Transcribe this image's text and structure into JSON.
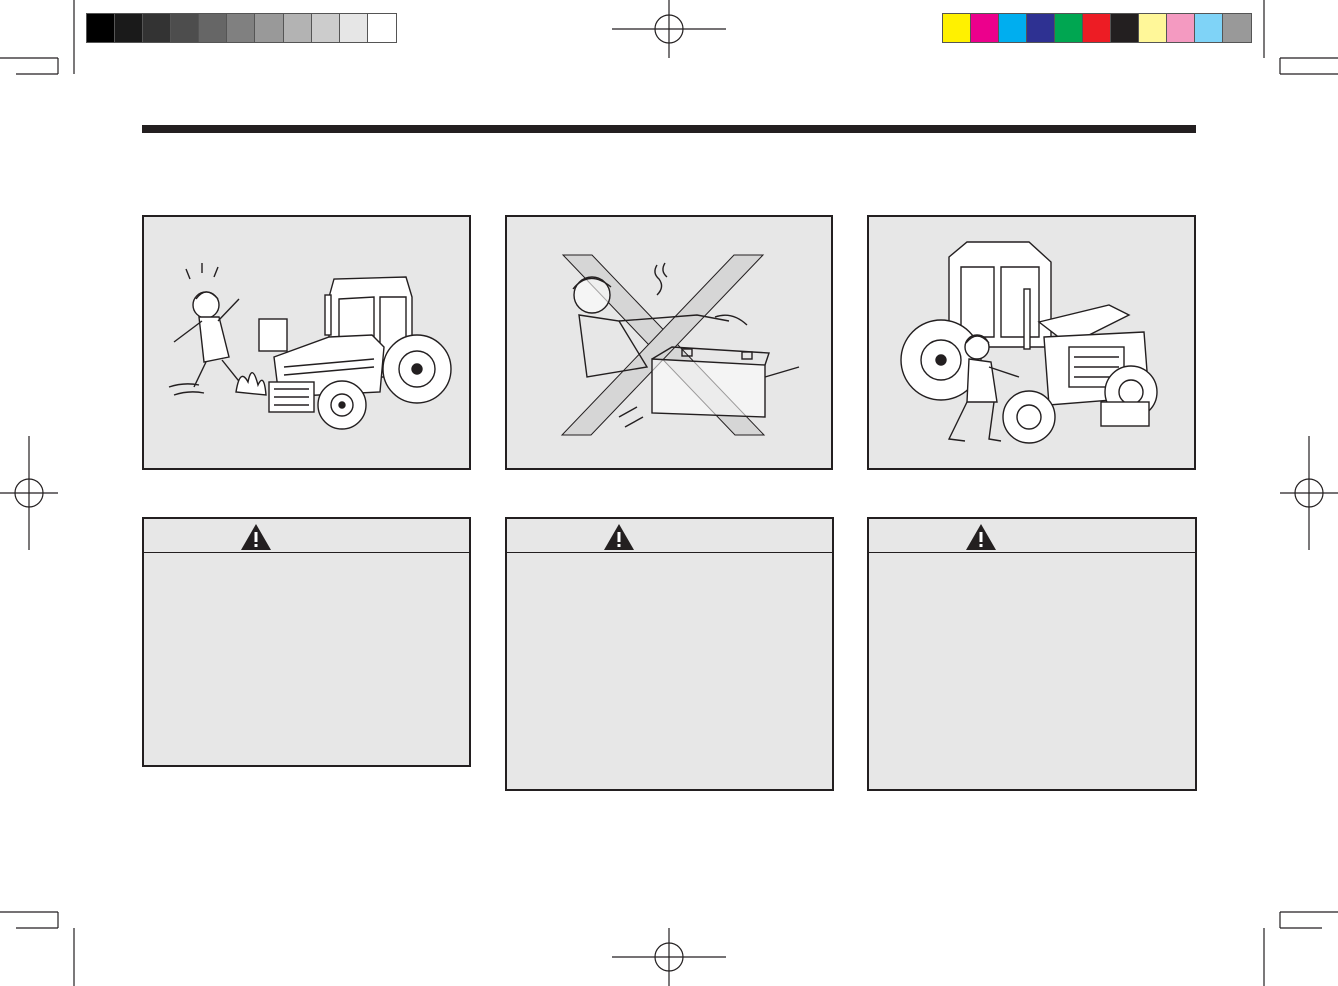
{
  "color_bar_left": [
    "#000000",
    "#1a1a1a",
    "#333333",
    "#4d4d4d",
    "#666666",
    "#808080",
    "#999999",
    "#b3b3b3",
    "#cccccc",
    "#e6e6e6",
    "#ffffff"
  ],
  "color_bar_right": [
    "#fff100",
    "#ec008c",
    "#00aeef",
    "#2e3192",
    "#00a651",
    "#ed1c24",
    "#231f20",
    "#fff799",
    "#f49ac1",
    "#7fd3f7",
    "#999999"
  ],
  "page_bg": "#ffffff",
  "panel_fill": "#e7e7e7",
  "ink": "#231f20",
  "illustrations": [
    {
      "icon": "tractor-fire-hazard-icon"
    },
    {
      "icon": "battery-no-smoking-icon"
    },
    {
      "icon": "tractor-maintenance-icon"
    }
  ],
  "warnings": [
    {
      "icon": "warning-triangle-icon",
      "text": ""
    },
    {
      "icon": "warning-triangle-icon",
      "text": ""
    },
    {
      "icon": "warning-triangle-icon",
      "text": ""
    }
  ]
}
